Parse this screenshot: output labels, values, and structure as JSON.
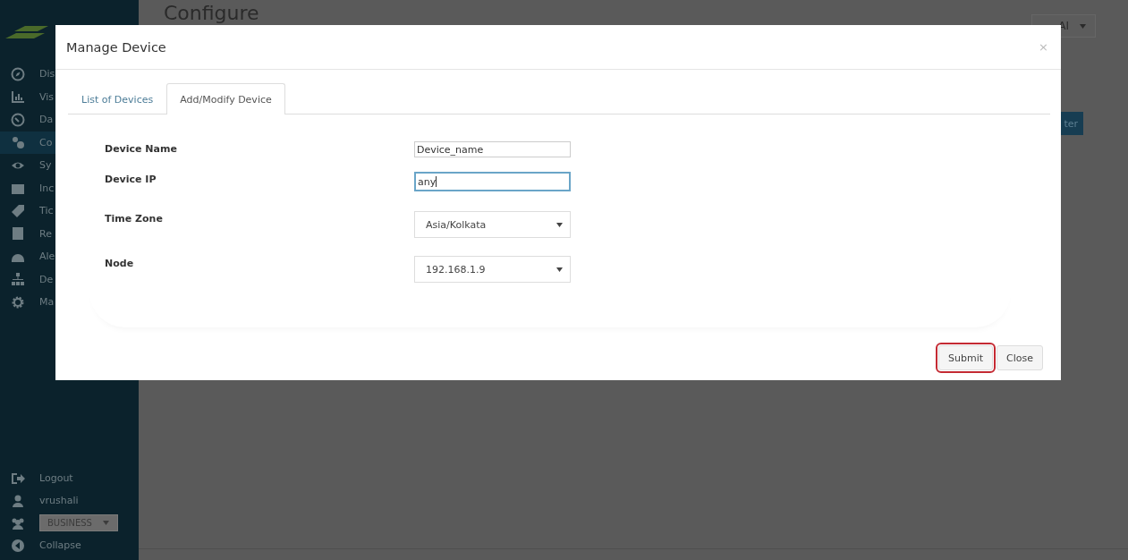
{
  "header": {
    "title": "Configure",
    "account_dropdown": {
      "value": "AI"
    },
    "action_button": "ter"
  },
  "sidebar": {
    "items": [
      {
        "label": "Dis",
        "selected": false
      },
      {
        "label": "Vis",
        "selected": false
      },
      {
        "label": "Da",
        "selected": false
      },
      {
        "label": "Co",
        "selected": true
      },
      {
        "label": "Sy",
        "selected": false
      },
      {
        "label": "Inc",
        "selected": false
      },
      {
        "label": "Tic",
        "selected": false
      },
      {
        "label": "Re",
        "selected": false
      },
      {
        "label": "Ale",
        "selected": false
      },
      {
        "label": "De",
        "selected": false
      },
      {
        "label": "Ma",
        "selected": false
      }
    ],
    "footer": {
      "logout": "Logout",
      "user": "vrushali",
      "business": "BUSINESS",
      "collapse": "Collapse"
    }
  },
  "modal": {
    "title": "Manage Device",
    "close": "×",
    "tabs": [
      {
        "label": "List of Devices",
        "selected": false
      },
      {
        "label": "Add/Modify Device",
        "selected": true
      }
    ],
    "fields": [
      {
        "kind": "text",
        "label": "Device Name",
        "value": "Device_name",
        "focused": false
      },
      {
        "kind": "text",
        "label": "Device IP",
        "value": "any",
        "focused": true
      },
      {
        "kind": "select",
        "label": "Time Zone",
        "value": "Asia/Kolkata"
      },
      {
        "kind": "select",
        "label": "Node",
        "value": "192.168.1.9"
      }
    ],
    "buttons": [
      {
        "label": "Submit",
        "highlighted": true
      },
      {
        "label": "Close",
        "highlighted": false
      }
    ]
  }
}
